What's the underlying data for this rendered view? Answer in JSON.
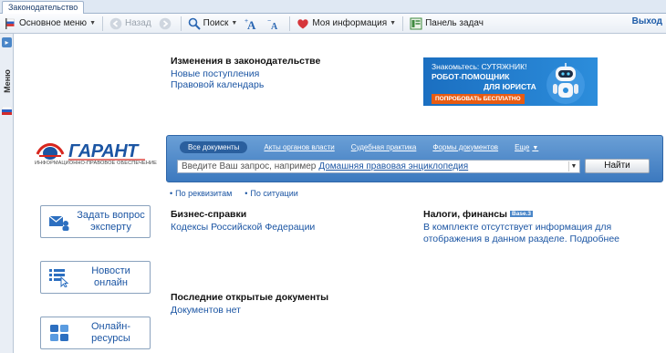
{
  "tabs": {
    "active_label": "Законодательство"
  },
  "toolbar": {
    "main_menu": "Основное меню",
    "back": "Назад",
    "search": "Поиск",
    "my_info": "Моя информация",
    "taskbar": "Панель задач",
    "exit": "Выход"
  },
  "sidebar": {
    "menu_label": "Меню"
  },
  "news": {
    "title": "Изменения в законодательстве",
    "links": [
      "Новые поступления",
      "Правовой календарь"
    ]
  },
  "ad": {
    "line1": "Знакомьтесь: СУТЯЖНИК!",
    "line2": "РОБОТ-ПОМОЩНИК",
    "line3": "ДЛЯ ЮРИСТА",
    "button": "ПОПРОБОВАТЬ БЕСПЛАТНО"
  },
  "logo": {
    "text": "ГАРАНТ",
    "subtitle": "ИНФОРМАЦИОННО-ПРАВОВОЕ ОБЕСПЕЧЕНИЕ"
  },
  "search": {
    "tabs": [
      "Все документы",
      "Акты органов власти",
      "Судебная практика",
      "Формы документов",
      "Еще"
    ],
    "placeholder": "Введите Ваш запрос, например",
    "example": "Домашняя правовая энциклопедия",
    "button": "Найти",
    "subnav": [
      "По реквизитам",
      "По ситуации"
    ]
  },
  "actions": [
    "Задать вопрос эксперту",
    "Новости онлайн",
    "Онлайн-ресурсы"
  ],
  "business": {
    "title": "Бизнес-справки",
    "link": "Кодексы Российской Федерации"
  },
  "taxes": {
    "title": "Налоги, финансы",
    "badge": "Base.3",
    "text": "В комплекте отсутствует информация для отображения в данном разделе. Подробнее"
  },
  "recent": {
    "title": "Последние открытые документы",
    "empty": "Документов нет"
  },
  "colors": {
    "accent": "#1b55a3",
    "panel": "#3c79bf",
    "brand_red": "#d7261e",
    "ad_orange": "#e85b12"
  }
}
